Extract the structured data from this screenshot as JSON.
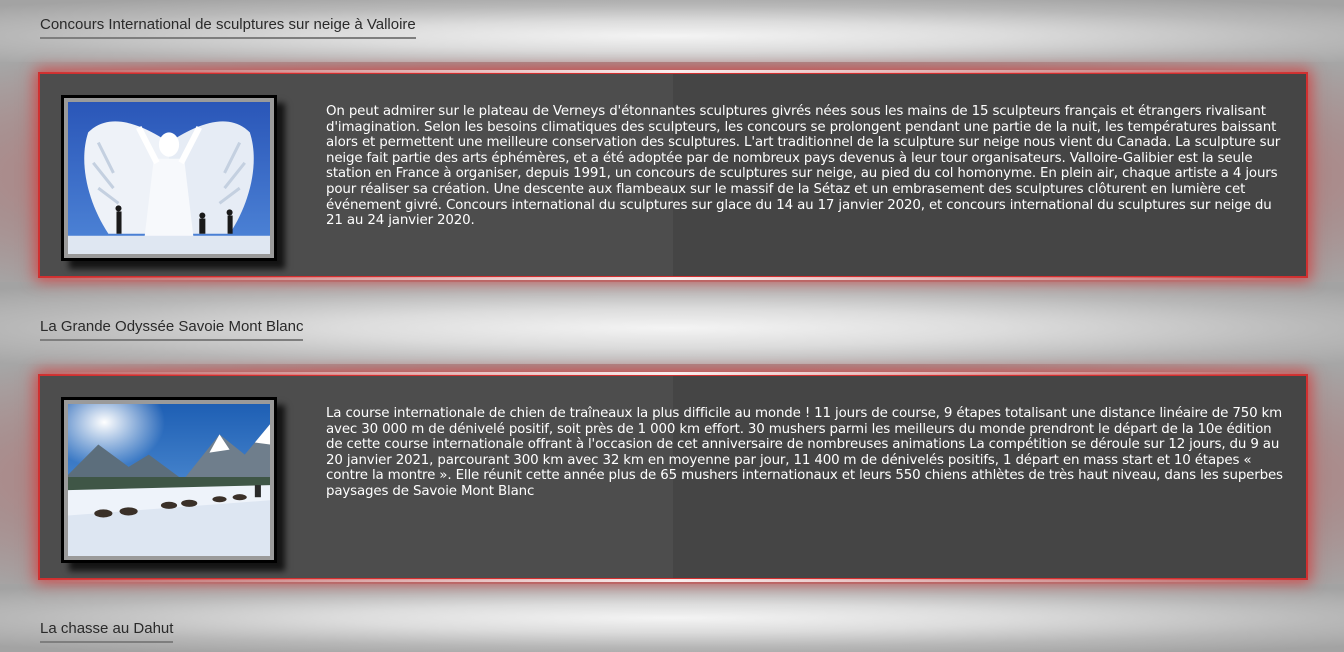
{
  "sections": [
    {
      "title": "Concours International de sculptures sur neige à Valloire",
      "image_icon": "snow-sculpture-photo",
      "text": "On peut admirer sur le plateau de Verneys d'étonnantes sculptures givrés nées sous les mains de 15 sculpteurs français et étrangers rivalisant d'imagination. Selon les besoins climatiques des sculpteurs, les concours se prolongent pendant une partie de la nuit, les températures baissant alors et permettent une meilleure conservation des sculptures. L'art traditionnel de la sculpture sur neige nous vient du Canada. La sculpture sur neige fait partie des arts éphémères, et a été adoptée par de nombreux pays devenus à leur tour organisateurs. Valloire-Galibier est la seule station en France à organiser, depuis 1991, un concours de sculptures sur neige, au pied du col homonyme. En plein air, chaque artiste a 4 jours pour réaliser sa création. Une descente aux flambeaux sur le massif de la Sétaz et un embrasement des sculptures clôturent en lumière cet événement givré. Concours international du sculptures sur glace du 14 au 17 janvier 2020, et concours international du sculptures sur neige du 21 au 24 janvier 2020."
    },
    {
      "title": "La Grande Odyssée Savoie Mont Blanc",
      "image_icon": "dog-sled-photo",
      "text": "La course internationale de chien de traîneaux la plus difficile au monde ! 11 jours de course, 9 étapes totalisant une distance linéaire de 750 km avec 30 000 m de dénivelé positif, soit près de 1 000 km effort. 30 mushers parmi les meilleurs du monde prendront le départ de la 10e édition de cette course internationale offrant à l'occasion de cet anniversaire de nombreuses animations La compétition se déroule sur 12 jours, du 9 au 20 janvier 2021, parcourant 300 km avec 32 km en moyenne par jour, 11 400 m de dénivelés positifs, 1 départ en mass start et 10 étapes « contre la montre ». Elle réunit cette année plus de 65 mushers internationaux et leurs 550 chiens athlètes de très haut niveau, dans les superbes paysages de Savoie Mont Blanc"
    },
    {
      "title": "La chasse au Dahut"
    }
  ],
  "colors": {
    "panel_border": "#d03030",
    "panel_bg": "#4d4d4d",
    "text": "#ffffff",
    "heading_text": "#2a2a2a"
  }
}
